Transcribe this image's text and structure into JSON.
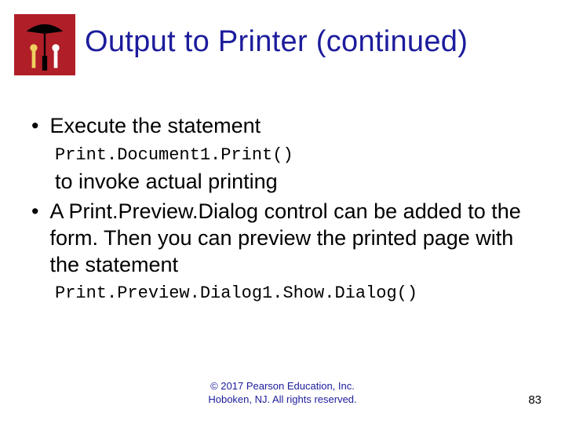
{
  "title": "Output to Printer (continued)",
  "bullets": {
    "b1": "Execute the statement",
    "code1": "Print.Document1.Print()",
    "cont1": "to invoke actual printing",
    "b2": "A Print.Preview.Dialog control can be added to the form. Then you can preview the printed page with the statement",
    "code2": "Print.Preview.Dialog1.Show.Dialog()"
  },
  "footer": {
    "line1": "© 2017 Pearson Education, Inc.",
    "line2": "Hoboken, NJ. All rights reserved."
  },
  "page": "83",
  "logo": {
    "bg": "#b01f28",
    "accent1": "#000000",
    "accent2": "#f0d060",
    "accent3": "#ffffff"
  }
}
